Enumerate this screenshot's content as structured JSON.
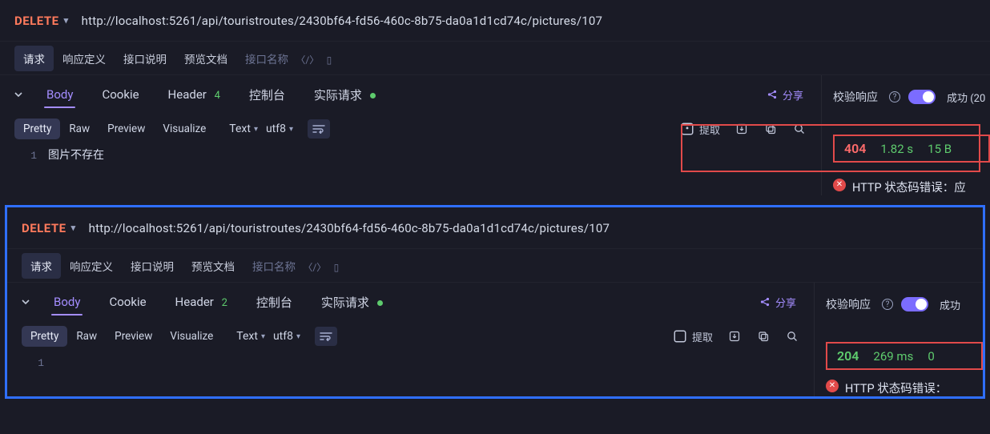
{
  "panel1": {
    "method": "DELETE",
    "url": "http://localhost:5261/api/touristroutes/2430bf64-fd56-460c-8b75-da0a1d1cd74c/pictures/107",
    "secTabs": {
      "request": "请求",
      "responseDef": "响应定义",
      "apiDesc": "接口说明",
      "previewDoc": "预览文档",
      "placeholder": "接口名称"
    },
    "bodyTabs": {
      "body": "Body",
      "cookie": "Cookie",
      "header": "Header",
      "headerCount": "4",
      "console": "控制台",
      "realReq": "实际请求"
    },
    "share": "分享",
    "toolbar": {
      "pretty": "Pretty",
      "raw": "Raw",
      "preview": "Preview",
      "visualize": "Visualize",
      "textFmt": "Text",
      "enc": "utf8",
      "extract": "提取"
    },
    "gutter1": "1",
    "bodyLine1": "图片不存在",
    "side": {
      "validate": "校验响应",
      "result": "成功 (20",
      "status": "404",
      "time": "1.82 s",
      "size": "15 B",
      "error": "HTTP 状态码错误：应"
    }
  },
  "panel2": {
    "method": "DELETE",
    "url": "http://localhost:5261/api/touristroutes/2430bf64-fd56-460c-8b75-da0a1d1cd74c/pictures/107",
    "secTabs": {
      "request": "请求",
      "responseDef": "响应定义",
      "apiDesc": "接口说明",
      "previewDoc": "预览文档",
      "placeholder": "接口名称"
    },
    "bodyTabs": {
      "body": "Body",
      "cookie": "Cookie",
      "header": "Header",
      "headerCount": "2",
      "console": "控制台",
      "realReq": "实际请求"
    },
    "share": "分享",
    "toolbar": {
      "pretty": "Pretty",
      "raw": "Raw",
      "preview": "Preview",
      "visualize": "Visualize",
      "textFmt": "Text",
      "enc": "utf8",
      "extract": "提取"
    },
    "gutter1": "1",
    "bodyLine1": "",
    "side": {
      "validate": "校验响应",
      "result": "成功",
      "status": "204",
      "time": "269 ms",
      "size": "0",
      "error": "HTTP 状态码错误："
    }
  }
}
